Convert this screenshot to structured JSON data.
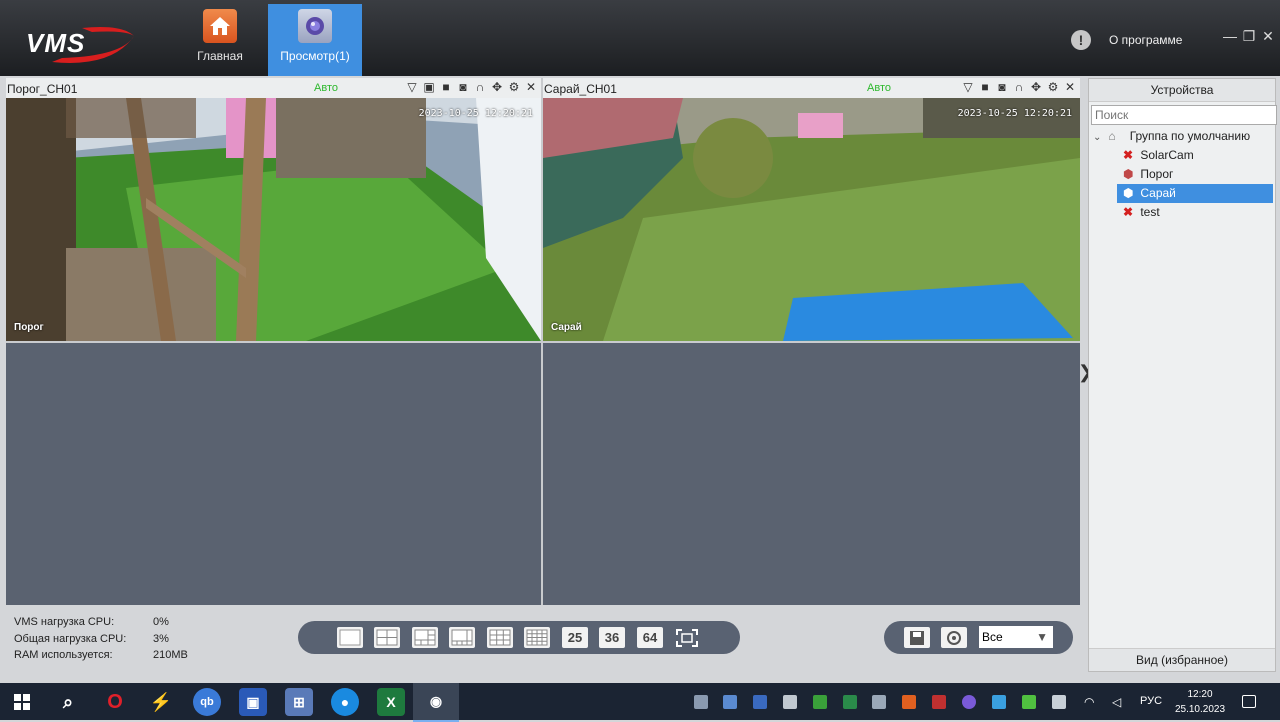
{
  "app": {
    "logo_text": "VMS",
    "about_label": "О программе"
  },
  "nav": {
    "tabs": [
      {
        "label": "Главная"
      },
      {
        "label": "Просмотр(1)"
      }
    ]
  },
  "cameras": [
    {
      "title": "Порог_CH01",
      "mode": "Авто",
      "osd_time": "2023-10-25 12:20:21",
      "osd_name": "Порог"
    },
    {
      "title": "Сарай_CH01",
      "mode": "Авто",
      "osd_time": "2023-10-25 12:20:21",
      "osd_name": "Сарай"
    }
  ],
  "devices_panel": {
    "title": "Устройства",
    "search_placeholder": "Поиск",
    "group": "Группа по умолчанию",
    "devices": [
      {
        "name": "SolarCam",
        "status": "offline"
      },
      {
        "name": "Порог",
        "status": "online"
      },
      {
        "name": "Сарай",
        "status": "online",
        "selected": true
      },
      {
        "name": "test",
        "status": "offline"
      }
    ],
    "footer": "Вид (избранное)"
  },
  "stats": {
    "vms_cpu_label": "VMS нагрузка CPU:",
    "vms_cpu_value": "0%",
    "total_cpu_label": "Общая нагрузка CPU:",
    "total_cpu_value": "3%",
    "ram_label": "RAM используется:",
    "ram_value": "210MB"
  },
  "layout_toolbar": {
    "buttons": [
      "1",
      "4",
      "6",
      "8",
      "9",
      "16",
      "25",
      "36",
      "64",
      "fullscreen"
    ],
    "labels": {
      "b25": "25",
      "b36": "36",
      "b64": "64"
    }
  },
  "stream_select": {
    "value": "Все"
  },
  "taskbar": {
    "lang": "РУС",
    "time": "12:20",
    "date": "25.10.2023"
  },
  "colors": {
    "accent": "#3f8fe0",
    "mode_green": "#2db82d",
    "empty_cell": "#5a6270"
  }
}
